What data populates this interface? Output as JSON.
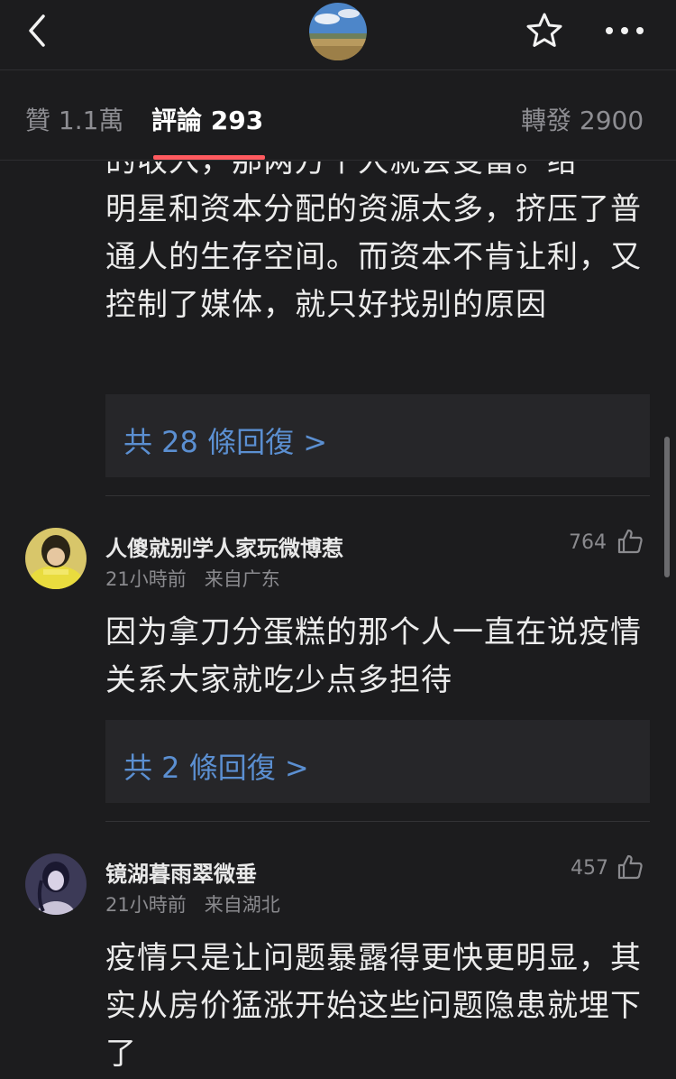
{
  "nav": {
    "back_icon": "chevron-left-icon",
    "star_icon": "star-outline-icon",
    "more_icon": "more-horizontal-icon"
  },
  "tabs": {
    "likes": "贊 1.1萬",
    "comments": "評論 293",
    "reposts": "轉發 2900"
  },
  "first_comment": {
    "partial_line": "的收入，那两万个人就会变富。给",
    "text": "明星和资本分配的资源太多，挤压了普通人的生存空间。而资本不肯让利，又控制了媒体，就只好找别的原因",
    "replies": "共 28 條回復 >"
  },
  "comments": [
    {
      "username": "人傻就别学人家玩微博惹",
      "time": "21小時前",
      "location": "来自广东",
      "likes": "764",
      "text": "因为拿刀分蛋糕的那个人一直在说疫情关系大家就吃少点多担待",
      "replies": "共 2 條回復 >"
    },
    {
      "username": "镜湖暮雨翠微垂",
      "time": "21小時前",
      "location": "来自湖北",
      "likes": "457",
      "text": "疫情只是让问题暴露得更快更明显，其实从房价猛涨开始这些问题隐患就埋下了"
    }
  ],
  "colors": {
    "background": "#1c1c1e",
    "accent": "#ff5a5f",
    "link": "#5b8fd1"
  }
}
